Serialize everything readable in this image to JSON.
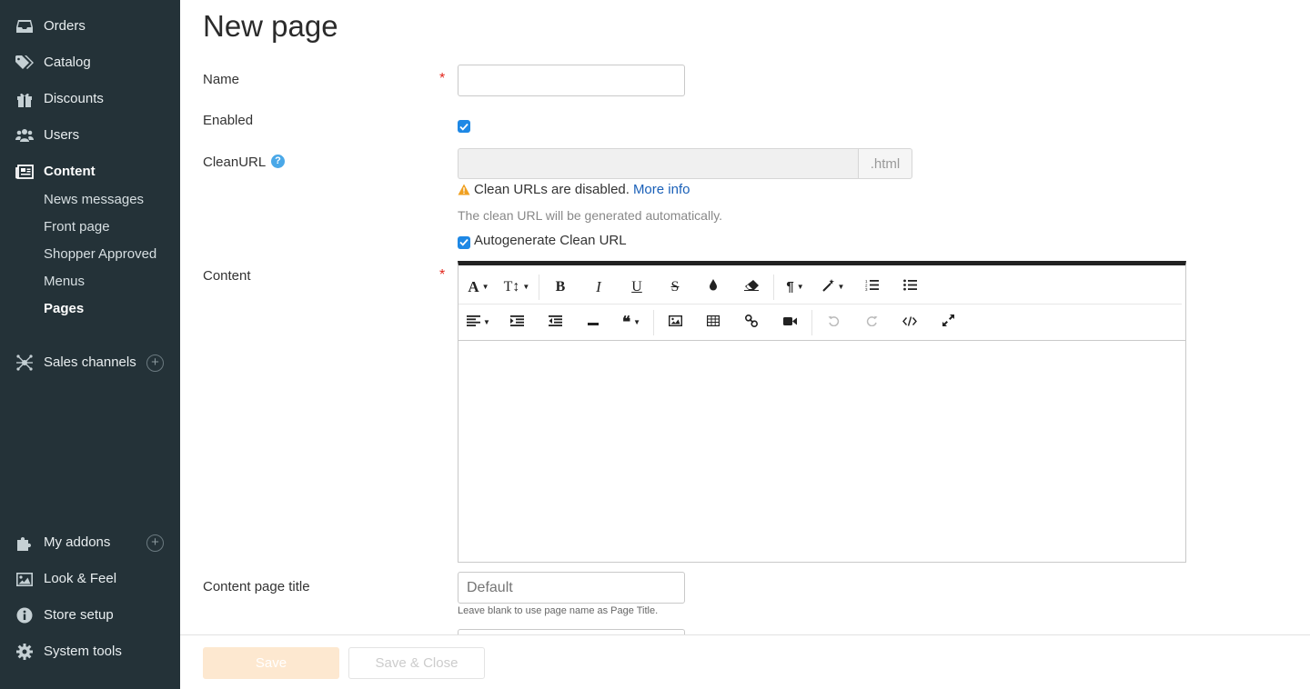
{
  "sidebar": {
    "items": [
      {
        "label": "Orders",
        "icon": "inbox-icon"
      },
      {
        "label": "Catalog",
        "icon": "tags-icon"
      },
      {
        "label": "Discounts",
        "icon": "gift-icon"
      },
      {
        "label": "Users",
        "icon": "users-icon"
      },
      {
        "label": "Content",
        "icon": "newspaper-icon",
        "active": true
      },
      {
        "label": "Sales channels",
        "icon": "network-icon"
      },
      {
        "label": "My addons",
        "icon": "puzzle-icon"
      },
      {
        "label": "Look & Feel",
        "icon": "image-icon"
      },
      {
        "label": "Store setup",
        "icon": "info-icon"
      },
      {
        "label": "System tools",
        "icon": "gear-icon"
      }
    ],
    "content_sub": [
      "News messages",
      "Front page",
      "Shopper Approved",
      "Menus",
      "Pages"
    ],
    "active_sub": "Pages"
  },
  "page": {
    "title": "New page",
    "name_label": "Name",
    "enabled_label": "Enabled",
    "enabled_checked": true,
    "cleanurl_label": "CleanURL",
    "cleanurl_suffix": ".html",
    "cleanurl_warning": "Clean URLs are disabled.",
    "cleanurl_more_info": "More info",
    "cleanurl_hint": "The clean URL will be generated automatically.",
    "autogenerate_label": "Autogenerate Clean URL",
    "autogenerate_checked": true,
    "content_label": "Content",
    "content_title_label": "Content page title",
    "content_title_placeholder": "Default",
    "content_title_hint": "Leave blank to use page name as Page Title."
  },
  "actions": {
    "save": "Save",
    "save_close": "Save & Close"
  },
  "colors": {
    "sidebar_bg": "#243238",
    "accent_blue": "#1e88e5",
    "required": "#e2251b",
    "save_disabled": "#fde8d0"
  }
}
